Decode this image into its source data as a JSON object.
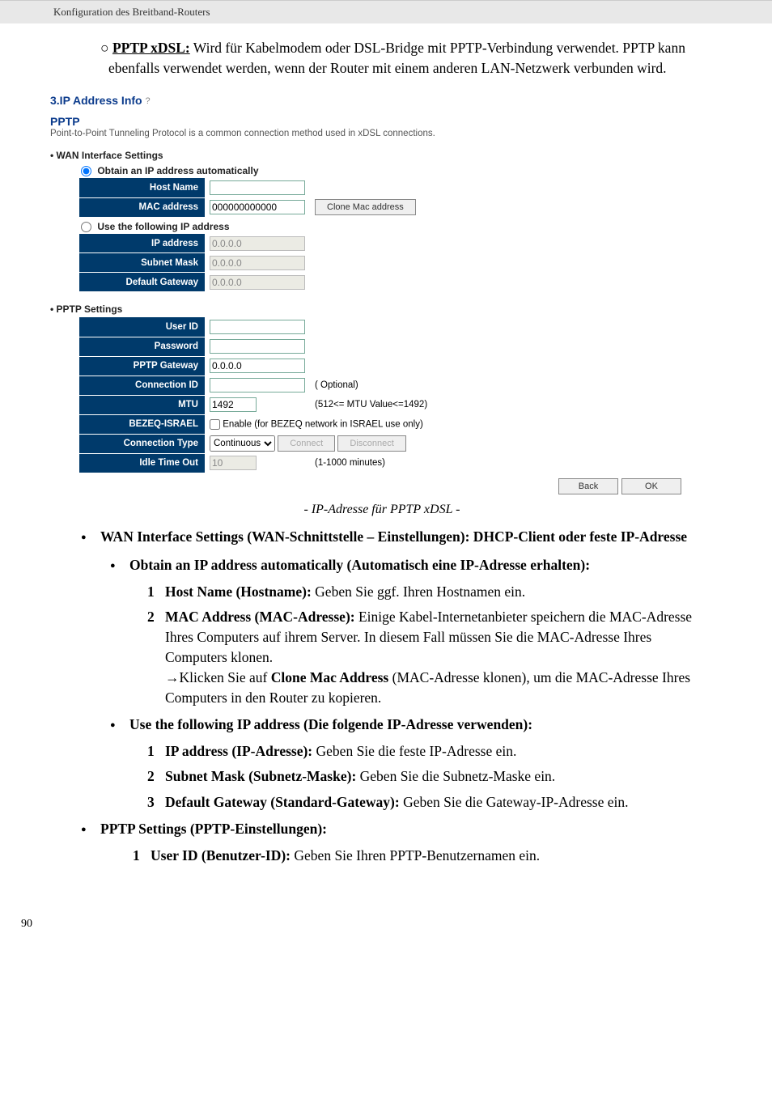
{
  "header": {
    "title": "Konfiguration des Breitband-Routers"
  },
  "intro": {
    "bullet": "○",
    "label": "PPTP xDSL:",
    "text": "Wird für Kabelmodem oder DSL-Bridge mit PPTP-Verbindung verwendet. PPTP kann ebenfalls verwendet werden, wenn der Router mit einem anderen LAN-Netzwerk verbunden wird."
  },
  "screenshot": {
    "title": "3.IP Address Info",
    "help_glyph": "?",
    "subheading": "PPTP",
    "subnote": "Point-to-Point Tunneling Protocol is a common connection method used in xDSL connections.",
    "wan_heading": "WAN Interface Settings",
    "radio_auto": "Obtain an IP address automatically",
    "radio_fixed": "Use the following IP address",
    "rows_auto": {
      "host_name": {
        "label": "Host Name",
        "value": ""
      },
      "mac": {
        "label": "MAC address",
        "value": "000000000000",
        "btn": "Clone Mac address"
      }
    },
    "rows_fixed": {
      "ip": {
        "label": "IP address",
        "value": "0.0.0.0"
      },
      "mask": {
        "label": "Subnet Mask",
        "value": "0.0.0.0"
      },
      "gw": {
        "label": "Default Gateway",
        "value": "0.0.0.0"
      }
    },
    "pptp_heading": "PPTP Settings",
    "pptp": {
      "user": {
        "label": "User ID",
        "value": ""
      },
      "password": {
        "label": "Password",
        "value": ""
      },
      "gateway": {
        "label": "PPTP Gateway",
        "value": "0.0.0.0"
      },
      "connid": {
        "label": "Connection ID",
        "value": "",
        "hint": "( Optional)"
      },
      "mtu": {
        "label": "MTU",
        "value": "1492",
        "hint": "(512<= MTU Value<=1492)"
      },
      "bezeq": {
        "label": "BEZEQ-ISRAEL",
        "hint": "Enable (for BEZEQ network in ISRAEL use only)"
      },
      "conntype": {
        "label": "Connection Type",
        "value": "Continuous",
        "btn_connect": "Connect",
        "btn_disconnect": "Disconnect"
      },
      "idle": {
        "label": "Idle Time Out",
        "value": "10",
        "hint": "(1-1000 minutes)"
      }
    },
    "btn_back": "Back",
    "btn_ok": "OK"
  },
  "caption": "- IP-Adresse für PPTP xDSL -",
  "doc": {
    "wan_heading": "WAN Interface Settings (WAN-Schnittstelle – Einstellungen): DHCP-Client oder feste IP-Adresse",
    "obtain_heading": "Obtain an IP address automatically (Automatisch eine IP-Adresse erhalten):",
    "obtain_items": [
      {
        "n": "1",
        "bold": "Host Name (Hostname):",
        "rest": " Geben Sie ggf. Ihren Hostnamen ein."
      },
      {
        "n": "2",
        "bold": "MAC Address (MAC-Adresse):",
        "rest": " Einige Kabel-Internetanbieter speichern die MAC-Adresse Ihres Computers auf ihrem Server. In diesem Fall müssen Sie die MAC-Adresse Ihres Computers klonen."
      }
    ],
    "mac_hint_pre": "Klicken Sie auf ",
    "mac_hint_bold": "Clone Mac Address",
    "mac_hint_post": " (MAC-Adresse klonen), um die MAC-Adresse Ihres Computers in den Router zu kopieren.",
    "fixed_heading": "Use the following IP address (Die folgende IP-Adresse verwenden):",
    "fixed_items": [
      {
        "n": "1",
        "bold": "IP address (IP-Adresse):",
        "rest": " Geben Sie die feste IP-Adresse ein."
      },
      {
        "n": "2",
        "bold": "Subnet Mask (Subnetz-Maske):",
        "rest": " Geben Sie die Subnetz-Maske ein."
      },
      {
        "n": "3",
        "bold": "Default Gateway (Standard-Gateway):",
        "rest": " Geben Sie die Gateway-IP-Adresse ein."
      }
    ],
    "pptp_heading": "PPTP Settings (PPTP-Einstellungen):",
    "pptp_items": [
      {
        "n": "1",
        "bold": "User ID (Benutzer-ID):",
        "rest": " Geben Sie Ihren PPTP-Benutzernamen ein."
      }
    ]
  },
  "page_no": "90"
}
